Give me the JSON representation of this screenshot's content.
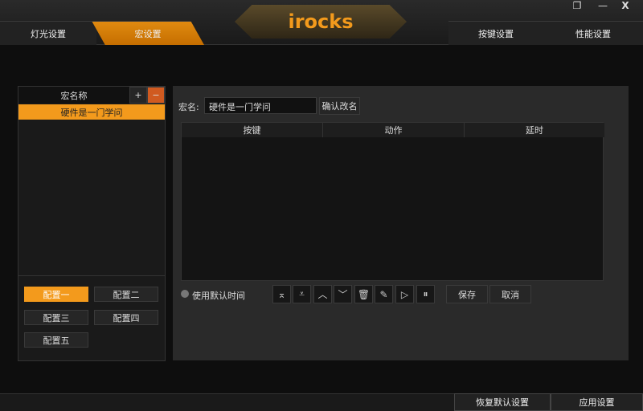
{
  "header": {
    "logo": "irocks",
    "tabs": [
      "灯光设置",
      "宏设置",
      "按键设置",
      "性能设置"
    ],
    "window": [
      "restore",
      "minimize",
      "close"
    ]
  },
  "macro_list": {
    "title": "宏名称",
    "add": "+",
    "remove": "−",
    "items": [
      "硬件是一门学问"
    ]
  },
  "profiles": [
    "配置一",
    "配置二",
    "配置三",
    "配置四",
    "配置五"
  ],
  "editor": {
    "name_label": "宏名:",
    "name_value": "硬件是一门学问",
    "rename": "确认改名",
    "columns": [
      "按键",
      "动作",
      "延时"
    ],
    "default_time": "使用默认时间",
    "save": "保存",
    "cancel": "取消"
  },
  "footer": {
    "restore": "恢复默认设置",
    "apply": "应用设置"
  },
  "accent": "#f39a1c"
}
